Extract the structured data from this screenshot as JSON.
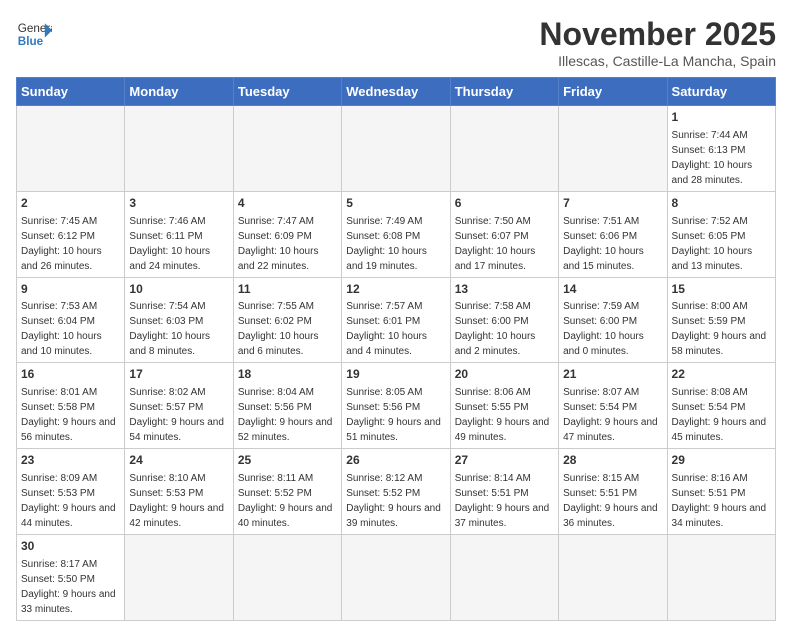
{
  "header": {
    "logo_general": "General",
    "logo_blue": "Blue",
    "month_title": "November 2025",
    "subtitle": "Illescas, Castille-La Mancha, Spain"
  },
  "weekdays": [
    "Sunday",
    "Monday",
    "Tuesday",
    "Wednesday",
    "Thursday",
    "Friday",
    "Saturday"
  ],
  "weeks": [
    [
      {
        "day": null,
        "info": null
      },
      {
        "day": null,
        "info": null
      },
      {
        "day": null,
        "info": null
      },
      {
        "day": null,
        "info": null
      },
      {
        "day": null,
        "info": null
      },
      {
        "day": null,
        "info": null
      },
      {
        "day": "1",
        "info": "Sunrise: 7:44 AM\nSunset: 6:13 PM\nDaylight: 10 hours and 28 minutes."
      }
    ],
    [
      {
        "day": "2",
        "info": "Sunrise: 7:45 AM\nSunset: 6:12 PM\nDaylight: 10 hours and 26 minutes."
      },
      {
        "day": "3",
        "info": "Sunrise: 7:46 AM\nSunset: 6:11 PM\nDaylight: 10 hours and 24 minutes."
      },
      {
        "day": "4",
        "info": "Sunrise: 7:47 AM\nSunset: 6:09 PM\nDaylight: 10 hours and 22 minutes."
      },
      {
        "day": "5",
        "info": "Sunrise: 7:49 AM\nSunset: 6:08 PM\nDaylight: 10 hours and 19 minutes."
      },
      {
        "day": "6",
        "info": "Sunrise: 7:50 AM\nSunset: 6:07 PM\nDaylight: 10 hours and 17 minutes."
      },
      {
        "day": "7",
        "info": "Sunrise: 7:51 AM\nSunset: 6:06 PM\nDaylight: 10 hours and 15 minutes."
      },
      {
        "day": "8",
        "info": "Sunrise: 7:52 AM\nSunset: 6:05 PM\nDaylight: 10 hours and 13 minutes."
      }
    ],
    [
      {
        "day": "9",
        "info": "Sunrise: 7:53 AM\nSunset: 6:04 PM\nDaylight: 10 hours and 10 minutes."
      },
      {
        "day": "10",
        "info": "Sunrise: 7:54 AM\nSunset: 6:03 PM\nDaylight: 10 hours and 8 minutes."
      },
      {
        "day": "11",
        "info": "Sunrise: 7:55 AM\nSunset: 6:02 PM\nDaylight: 10 hours and 6 minutes."
      },
      {
        "day": "12",
        "info": "Sunrise: 7:57 AM\nSunset: 6:01 PM\nDaylight: 10 hours and 4 minutes."
      },
      {
        "day": "13",
        "info": "Sunrise: 7:58 AM\nSunset: 6:00 PM\nDaylight: 10 hours and 2 minutes."
      },
      {
        "day": "14",
        "info": "Sunrise: 7:59 AM\nSunset: 6:00 PM\nDaylight: 10 hours and 0 minutes."
      },
      {
        "day": "15",
        "info": "Sunrise: 8:00 AM\nSunset: 5:59 PM\nDaylight: 9 hours and 58 minutes."
      }
    ],
    [
      {
        "day": "16",
        "info": "Sunrise: 8:01 AM\nSunset: 5:58 PM\nDaylight: 9 hours and 56 minutes."
      },
      {
        "day": "17",
        "info": "Sunrise: 8:02 AM\nSunset: 5:57 PM\nDaylight: 9 hours and 54 minutes."
      },
      {
        "day": "18",
        "info": "Sunrise: 8:04 AM\nSunset: 5:56 PM\nDaylight: 9 hours and 52 minutes."
      },
      {
        "day": "19",
        "info": "Sunrise: 8:05 AM\nSunset: 5:56 PM\nDaylight: 9 hours and 51 minutes."
      },
      {
        "day": "20",
        "info": "Sunrise: 8:06 AM\nSunset: 5:55 PM\nDaylight: 9 hours and 49 minutes."
      },
      {
        "day": "21",
        "info": "Sunrise: 8:07 AM\nSunset: 5:54 PM\nDaylight: 9 hours and 47 minutes."
      },
      {
        "day": "22",
        "info": "Sunrise: 8:08 AM\nSunset: 5:54 PM\nDaylight: 9 hours and 45 minutes."
      }
    ],
    [
      {
        "day": "23",
        "info": "Sunrise: 8:09 AM\nSunset: 5:53 PM\nDaylight: 9 hours and 44 minutes."
      },
      {
        "day": "24",
        "info": "Sunrise: 8:10 AM\nSunset: 5:53 PM\nDaylight: 9 hours and 42 minutes."
      },
      {
        "day": "25",
        "info": "Sunrise: 8:11 AM\nSunset: 5:52 PM\nDaylight: 9 hours and 40 minutes."
      },
      {
        "day": "26",
        "info": "Sunrise: 8:12 AM\nSunset: 5:52 PM\nDaylight: 9 hours and 39 minutes."
      },
      {
        "day": "27",
        "info": "Sunrise: 8:14 AM\nSunset: 5:51 PM\nDaylight: 9 hours and 37 minutes."
      },
      {
        "day": "28",
        "info": "Sunrise: 8:15 AM\nSunset: 5:51 PM\nDaylight: 9 hours and 36 minutes."
      },
      {
        "day": "29",
        "info": "Sunrise: 8:16 AM\nSunset: 5:51 PM\nDaylight: 9 hours and 34 minutes."
      }
    ],
    [
      {
        "day": "30",
        "info": "Sunrise: 8:17 AM\nSunset: 5:50 PM\nDaylight: 9 hours and 33 minutes."
      },
      {
        "day": null,
        "info": null
      },
      {
        "day": null,
        "info": null
      },
      {
        "day": null,
        "info": null
      },
      {
        "day": null,
        "info": null
      },
      {
        "day": null,
        "info": null
      },
      {
        "day": null,
        "info": null
      }
    ]
  ]
}
